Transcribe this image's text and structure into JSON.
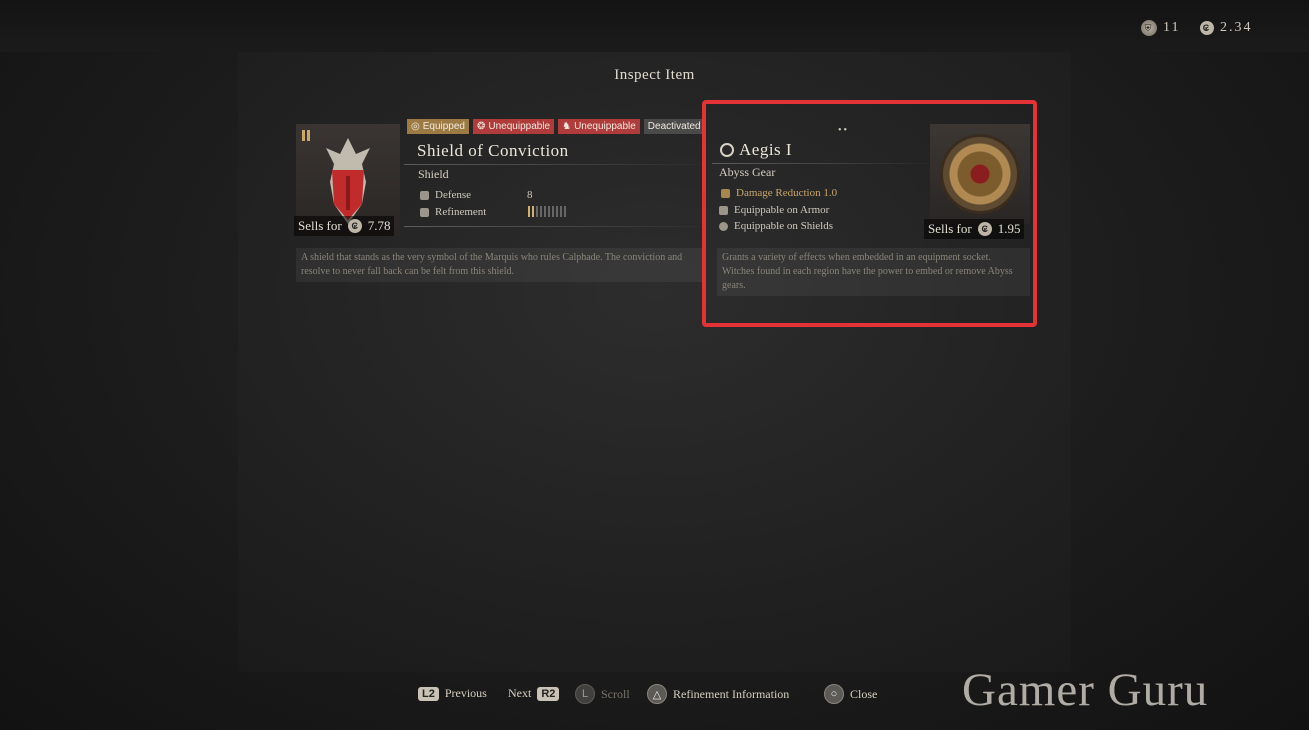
{
  "header": {
    "crest_count": "11",
    "silver_amount": "2.34",
    "coin_glyph": "₢",
    "title": "Inspect Item"
  },
  "left_item": {
    "badges": [
      "Equipped",
      "Unequippable",
      "Unequippable",
      "Deactivated"
    ],
    "name": "Shield of Conviction",
    "type": "Shield",
    "stats": [
      {
        "label": "Defense",
        "value": "8"
      },
      {
        "label": "Refinement",
        "value": ""
      }
    ],
    "refinement_level": 2,
    "refinement_max": 10,
    "sells_label": "Sells for",
    "sells_value": "7.78",
    "description": "A shield that stands as the very symbol of the Marquis who rules Calphade. The conviction and resolve to never fall back can be felt from this shield."
  },
  "right_item": {
    "page_dots": "••",
    "name": "Aegis I",
    "type": "Abyss Gear",
    "effect": "Damage Reduction 1.0",
    "equip_armor": "Equippable on Armor",
    "equip_shields": "Equippable on Shields",
    "sells_label": "Sells for",
    "sells_value": "1.95",
    "description": "Grants a variety of effects when embedded in an equipment socket. Witches found in each region have the power to embed or remove Abyss gears."
  },
  "footer": {
    "prev_key": "L2",
    "prev_label": "Previous",
    "next_label": "Next",
    "next_key": "R2",
    "scroll_key": "L",
    "scroll_label": "Scroll",
    "refine_key": "△",
    "refine_label": "Refinement Information",
    "close_key": "○",
    "close_label": "Close"
  },
  "watermark": "Gamer Guru",
  "colors": {
    "highlight": "#e53236",
    "equipped": "#9d7a44",
    "unequippable": "#b03b3b",
    "deactivated": "#4a4a4a"
  }
}
